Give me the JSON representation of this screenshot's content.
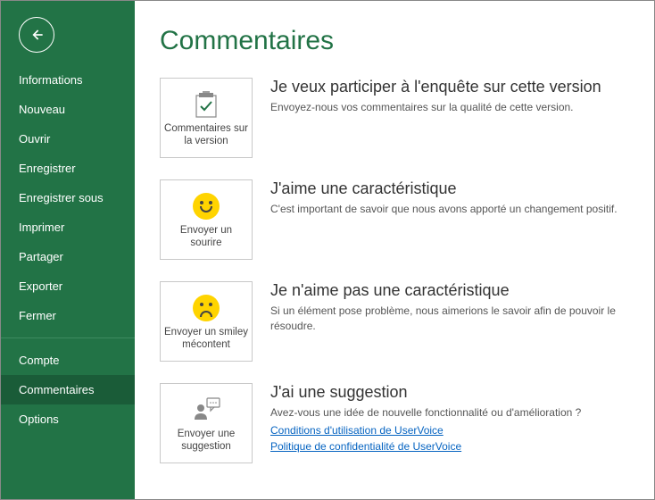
{
  "sidebar": {
    "items": [
      {
        "label": "Informations"
      },
      {
        "label": "Nouveau"
      },
      {
        "label": "Ouvrir"
      },
      {
        "label": "Enregistrer"
      },
      {
        "label": "Enregistrer sous"
      },
      {
        "label": "Imprimer"
      },
      {
        "label": "Partager"
      },
      {
        "label": "Exporter"
      },
      {
        "label": "Fermer"
      }
    ],
    "footer": [
      {
        "label": "Compte"
      },
      {
        "label": "Commentaires"
      },
      {
        "label": "Options"
      }
    ]
  },
  "page_title": "Commentaires",
  "tiles": [
    {
      "label": "Commentaires sur la version",
      "title": "Je veux participer à l'enquête sur cette version",
      "desc": "Envoyez-nous vos commentaires sur la qualité de cette version."
    },
    {
      "label": "Envoyer un sourire",
      "title": "J'aime une caractéristique",
      "desc": "C'est important de savoir que nous avons apporté un changement positif."
    },
    {
      "label": "Envoyer un smiley mécontent",
      "title": "Je n'aime pas une caractéristique",
      "desc": "Si un élément pose problème, nous aimerions le savoir afin de pouvoir le résoudre."
    },
    {
      "label": "Envoyer une suggestion",
      "title": "J'ai une suggestion",
      "desc": "Avez-vous une idée de nouvelle fonctionnalité ou d'amélioration ?",
      "link1": "Conditions d'utilisation de UserVoice",
      "link2": "Politique de confidentialité de UserVoice"
    }
  ]
}
